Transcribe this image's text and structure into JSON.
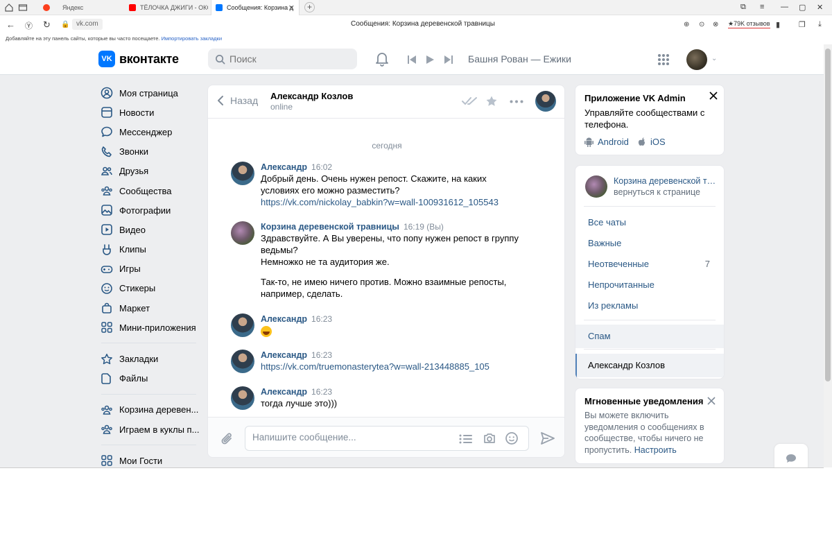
{
  "browser": {
    "tabs": [
      {
        "label": "Яндекс",
        "color": "#fc3f1d"
      },
      {
        "label": "ТЁЛОЧКА ДЖИГИ - ОКСА",
        "color": "#ff0000"
      },
      {
        "label": "Сообщения: Корзина д",
        "color": "#0077ff",
        "active": true
      }
    ],
    "url": "vk.com",
    "page_title": "Сообщения: Корзина деревенской травницы",
    "reviews": "★79K отзывов",
    "bookmarks_prompt": "Добавляйте на эту панель сайты, которые вы часто посещаете.",
    "bookmarks_link": "Импортировать закладки"
  },
  "header": {
    "logo_text": "вконтакте",
    "search_placeholder": "Поиск",
    "now_playing": "Башня Рован — Ежики"
  },
  "leftnav": {
    "items": [
      {
        "label": "Моя страница",
        "icon": "user-circle-icon"
      },
      {
        "label": "Новости",
        "icon": "newspaper-icon"
      },
      {
        "label": "Мессенджер",
        "icon": "chat-bubble-icon"
      },
      {
        "label": "Звонки",
        "icon": "phone-icon"
      },
      {
        "label": "Друзья",
        "icon": "friends-icon"
      },
      {
        "label": "Сообщества",
        "icon": "communities-icon"
      },
      {
        "label": "Фотографии",
        "icon": "photo-icon"
      },
      {
        "label": "Видео",
        "icon": "video-icon"
      },
      {
        "label": "Клипы",
        "icon": "clips-icon"
      },
      {
        "label": "Игры",
        "icon": "gamepad-icon"
      },
      {
        "label": "Стикеры",
        "icon": "smile-icon"
      },
      {
        "label": "Маркет",
        "icon": "bag-icon"
      },
      {
        "label": "Мини-приложения",
        "icon": "apps-grid-icon"
      }
    ],
    "items2": [
      {
        "label": "Закладки",
        "icon": "star-icon"
      },
      {
        "label": "Файлы",
        "icon": "file-icon"
      }
    ],
    "items3": [
      {
        "label": "Корзина деревен...",
        "icon": "communities-icon"
      },
      {
        "label": "Играем в куклы п...",
        "icon": "communities-icon"
      }
    ],
    "items4": [
      {
        "label": "Мои Гости",
        "icon": "apps-grid-icon"
      }
    ]
  },
  "chat": {
    "back_label": "Назад",
    "name": "Александр Козлов",
    "status": "online",
    "date_separator": "сегодня",
    "messages": [
      {
        "author": "Александр",
        "time": "16:02",
        "lines": [
          "Добрый день. Очень нужен репост. Скажите, на каких",
          "условиях его можно разместить?"
        ],
        "link": "https://vk.com/nickolay_babkin?w=wall-100931612_105543"
      },
      {
        "author": "Корзина деревенской травницы",
        "time": "16:19 (Вы)",
        "lines": [
          "Здравствуйте. А Вы уверены, что попу нужен репост в группу",
          "ведьмы?",
          "Немножко не та аудитория же."
        ],
        "lines2": [
          "Так-то, не имею ничего против. Можно взаимные репосты,",
          "например, сделать."
        ]
      },
      {
        "author": "Александр",
        "time": "16:23",
        "emoji": "grinning-emoji"
      },
      {
        "author": "Александр",
        "time": "16:23",
        "link": "https://vk.com/truemonasterytea?w=wall-213448885_105"
      },
      {
        "author": "Александр",
        "time": "16:23",
        "lines": [
          "тогда лучше это)))"
        ]
      }
    ],
    "composer_placeholder": "Напишите сообщение..."
  },
  "right": {
    "admin_title": "Приложение VK Admin",
    "admin_desc": "Управляйте сообществами с телефона.",
    "android": "Android",
    "ios": "iOS",
    "community_name": "Корзина деревенской травницы",
    "community_back": "вернуться к странице",
    "filters": [
      {
        "label": "Все чаты",
        "count": ""
      },
      {
        "label": "Важные",
        "count": ""
      },
      {
        "label": "Неотвеченные",
        "count": "7"
      },
      {
        "label": "Непрочитанные",
        "count": ""
      },
      {
        "label": "Из рекламы",
        "count": ""
      }
    ],
    "spam": "Спам",
    "selected_chat": "Александр Козлов",
    "notif_title": "Мгновенные уведомления",
    "notif_desc": "Вы можете включить уведомления о сообщениях в сообществе, чтобы ничего не пропустить.",
    "notif_link": "Настроить"
  },
  "colors": {
    "accent": "#0077ff",
    "link": "#2a5885",
    "muted": "#818c99",
    "bg": "#edeef0"
  }
}
